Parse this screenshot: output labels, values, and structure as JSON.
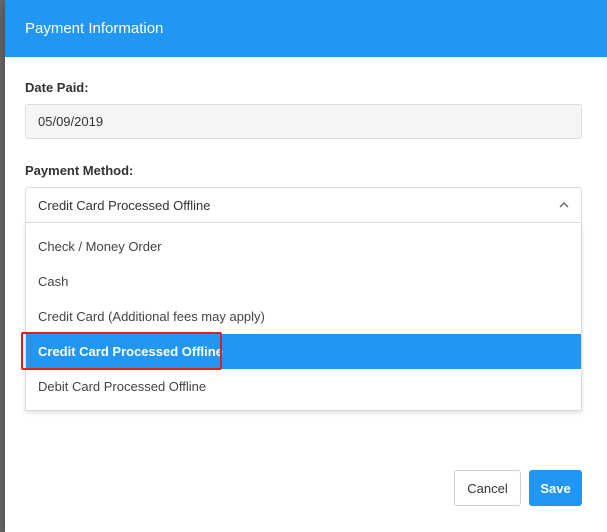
{
  "modal": {
    "title": "Payment Information",
    "date_label": "Date Paid:",
    "date_value": "05/09/2019",
    "method_label": "Payment Method:",
    "method_selected": "Credit Card Processed Offline",
    "options": [
      "Check / Money Order",
      "Cash",
      "Credit Card (Additional fees may apply)",
      "Credit Card Processed Offline",
      "Debit Card Processed Offline"
    ],
    "selected_index": 3,
    "cancel_label": "Cancel",
    "save_label": "Save"
  },
  "colors": {
    "accent": "#2196f3",
    "highlight": "#e02020"
  }
}
